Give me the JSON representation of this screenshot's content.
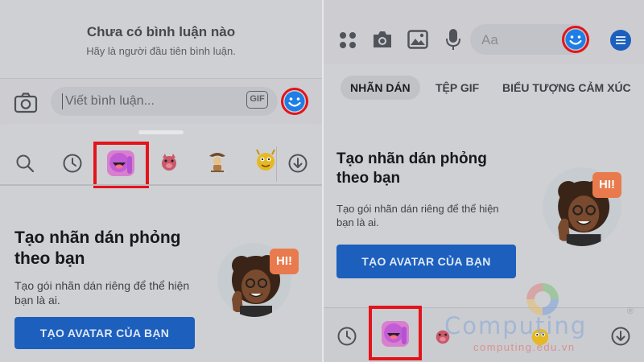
{
  "left": {
    "empty_title": "Chưa có bình luận nào",
    "empty_subtitle": "Hãy là người đầu tiên bình luận.",
    "comment_placeholder": "Viết bình luận...",
    "gif_label": "GIF",
    "promo": {
      "title_line1": "Tạo nhãn dán phỏng",
      "title_line2": "theo bạn",
      "desc_line1": "Tạo gói nhãn dán riêng để thể hiện",
      "desc_line2": "bạn là ai.",
      "button": "TẠO AVATAR CỦA BẠN",
      "hi_badge": "HI!"
    },
    "tray_icons": [
      "search-icon",
      "recent-clock-icon",
      "avatar-stickers-icon",
      "sticker-pig",
      "sticker-cowboy",
      "sticker-creature",
      "download-icon"
    ]
  },
  "right": {
    "message_placeholder": "Aa",
    "tabs": [
      "NHÃN DÁN",
      "TỆP GIF",
      "BIỂU TƯỢNG CẢM XÚC"
    ],
    "active_tab": "NHÃN DÁN",
    "promo": {
      "title_line1": "Tạo nhãn dán phỏng",
      "title_line2": "theo bạn",
      "desc_line1": "Tạo gói nhãn dán riêng để thể hiện",
      "desc_line2": "bạn là ai.",
      "button": "TẠO AVATAR CỦA BẠN",
      "hi_badge": "HI!"
    },
    "toolbar_icons": [
      "apps-icon",
      "camera-icon",
      "image-icon",
      "mic-icon",
      "emoji-icon",
      "menu-icon"
    ]
  },
  "watermark": {
    "brand": "Computing",
    "url": "computing.edu.vn",
    "registered": "®"
  },
  "colors": {
    "highlight_red": "#e3141b",
    "primary_blue": "#1c5fbd",
    "avatar_purple": "#d97fd0",
    "hi_orange": "#e97a4d"
  }
}
